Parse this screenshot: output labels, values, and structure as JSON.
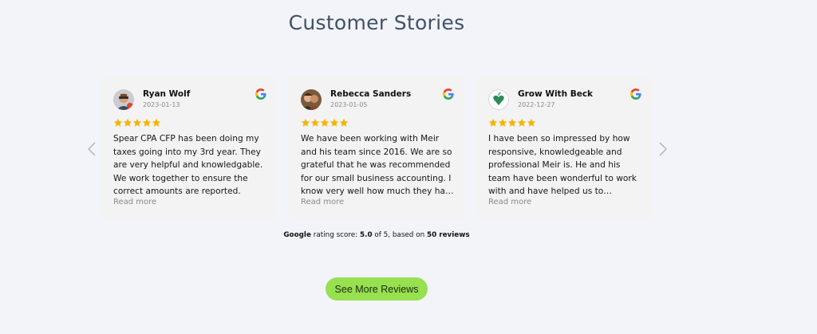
{
  "section": {
    "title": "Customer Stories"
  },
  "carousel": {
    "prev_icon": "chevron-left-icon",
    "next_icon": "chevron-right-icon",
    "star_color": "#f5b400",
    "reviews": [
      {
        "name": "Ryan Wolf",
        "date": "2023-01-13",
        "rating": 5,
        "text": "Spear CPA CFP has been doing my taxes going into my 3rd year. They are very helpful and knowledgable. We work together to ensure the correct amounts are reported.",
        "read_more": "Read more",
        "source_icon": "google-icon"
      },
      {
        "name": "Rebecca Sanders",
        "date": "2023-01-05",
        "rating": 5,
        "text": "We have been working with Meir and his team since 2016. We are so grateful that he was recommended for our small business accounting. I know very well how much they have helped us.",
        "read_more": "Read more",
        "source_icon": "google-icon"
      },
      {
        "name": "Grow With Beck",
        "date": "2022-12-27",
        "rating": 5,
        "text": "I have been so impressed by how responsive, knowledgeable and professional Meir is. He and his team have been wonderful to work with and have helped us to…",
        "read_more": "Read more",
        "source_icon": "google-icon"
      }
    ]
  },
  "rating_summary": {
    "source": "Google",
    "label": "rating score:",
    "score": "5.0",
    "of_text": "of 5, based on",
    "count": "50 reviews"
  },
  "cta": {
    "label": "See More Reviews",
    "color": "#97e04f"
  }
}
